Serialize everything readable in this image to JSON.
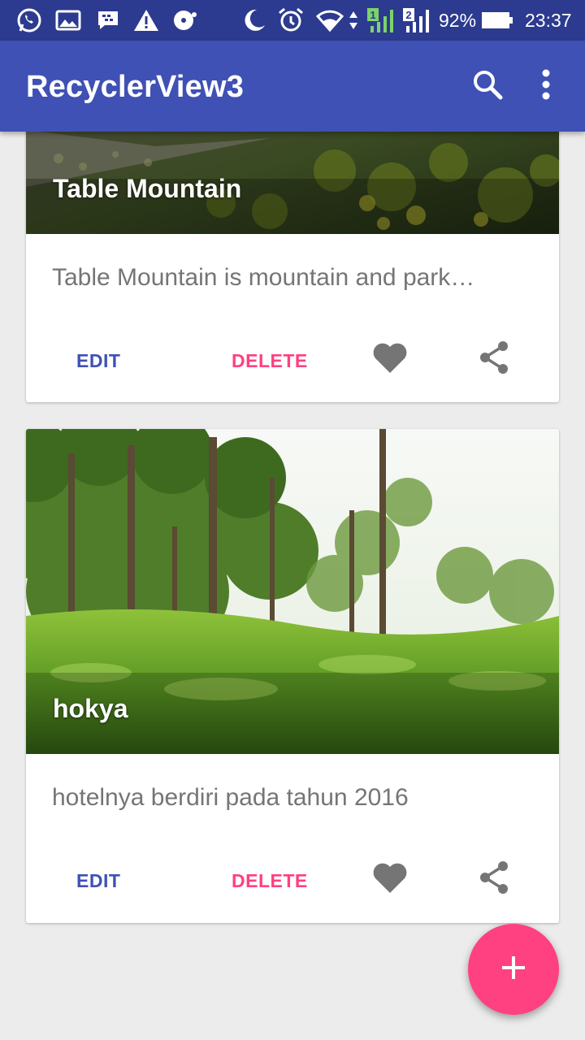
{
  "status_bar": {
    "battery_percent": "92%",
    "time": "23:37",
    "sim1_label": "1",
    "sim2_label": "2",
    "icons": [
      "whatsapp-icon",
      "gallery-icon",
      "bbm-icon",
      "warning-icon",
      "disc-icon",
      "moon-icon",
      "alarm-icon",
      "wifi-icon",
      "signal-icon",
      "battery-icon"
    ]
  },
  "app_bar": {
    "title": "RecyclerView3",
    "actions": [
      "search-icon",
      "more-vert-icon"
    ]
  },
  "cards": [
    {
      "title": "Table Mountain",
      "description": "Table Mountain is mountain and park…",
      "edit_label": "EDIT",
      "delete_label": "DELETE"
    },
    {
      "title": "hokya",
      "description": "hotelnya berdiri pada tahun 2016",
      "edit_label": "EDIT",
      "delete_label": "DELETE"
    }
  ],
  "fab": {
    "icon": "add-icon"
  },
  "colors": {
    "primary": "#3f51b5",
    "primary_dark": "#2c3b8f",
    "accent": "#ff4081",
    "icon_gray": "#757575"
  }
}
